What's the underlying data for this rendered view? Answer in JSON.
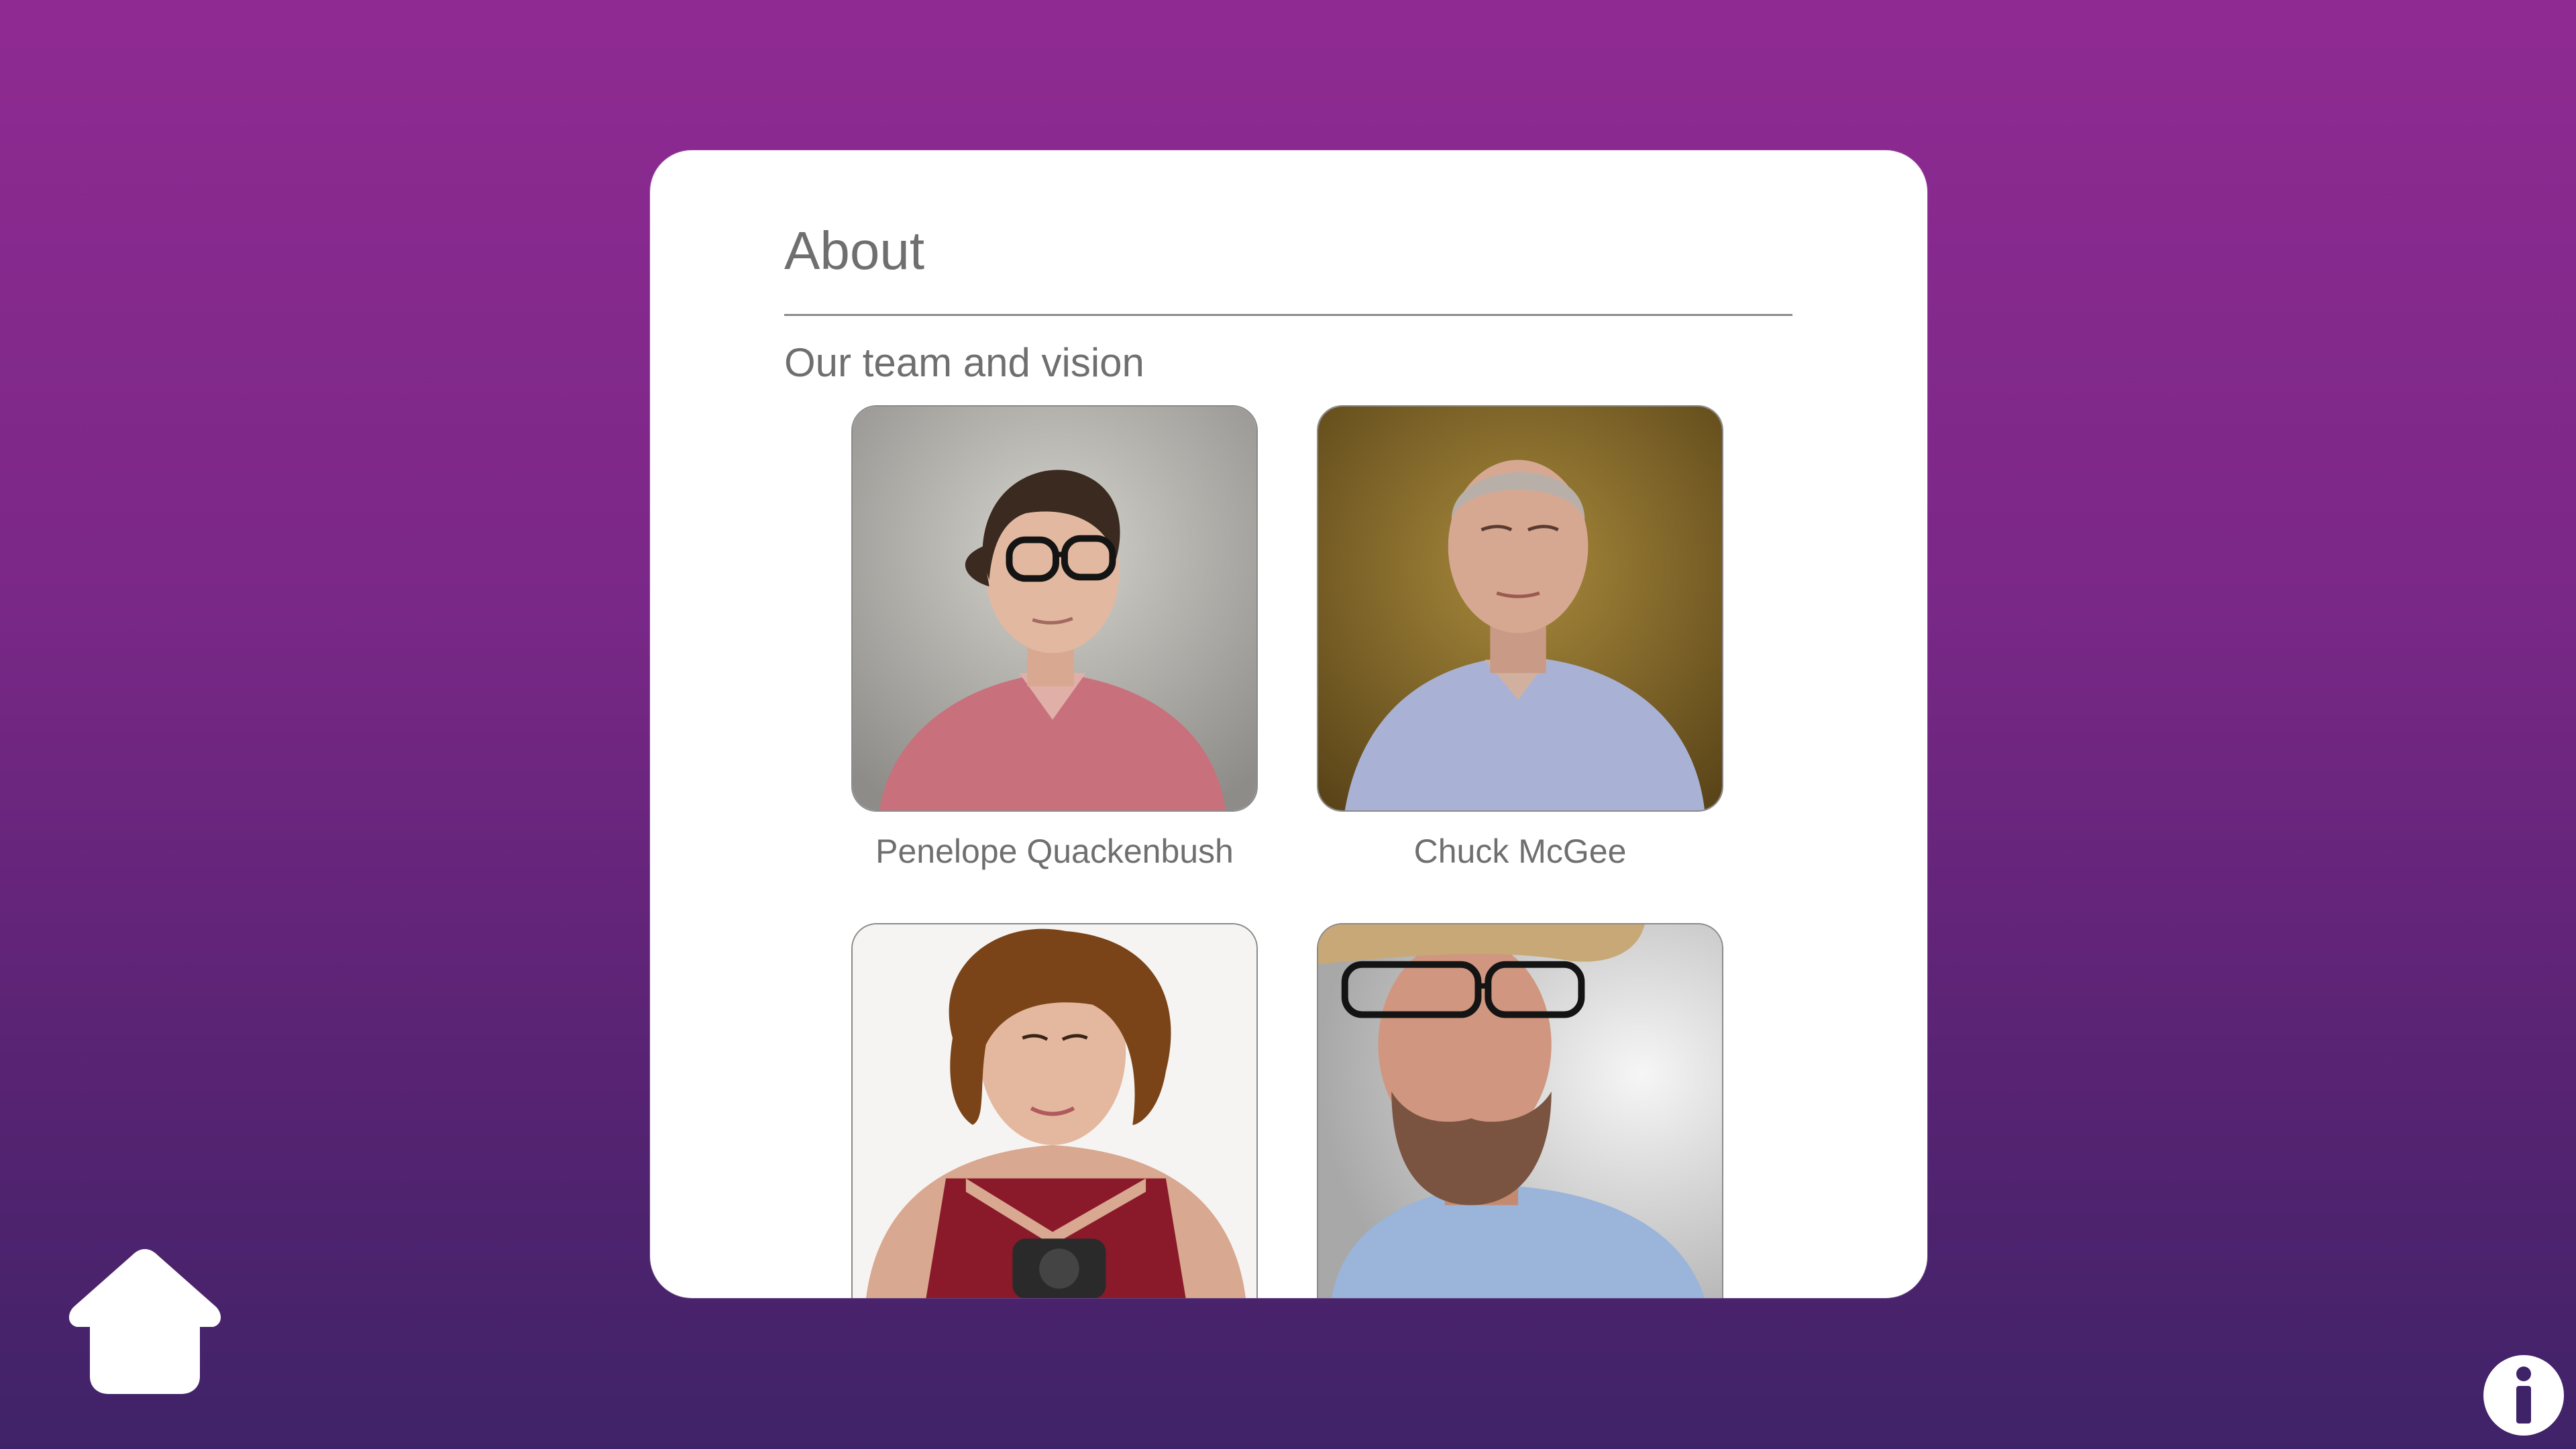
{
  "about": {
    "title": "About",
    "subtitle": "Our team and vision"
  },
  "team": {
    "members": [
      {
        "name": "Penelope Quackenbush"
      },
      {
        "name": "Chuck McGee"
      },
      {
        "name": ""
      },
      {
        "name": ""
      }
    ]
  },
  "nav": {
    "home_icon": "home-icon",
    "info_icon": "info-icon"
  },
  "colors": {
    "background_top": "#8f2a92",
    "background_bottom": "#3f2368",
    "card": "#ffffff",
    "text": "#6f6f6f"
  }
}
